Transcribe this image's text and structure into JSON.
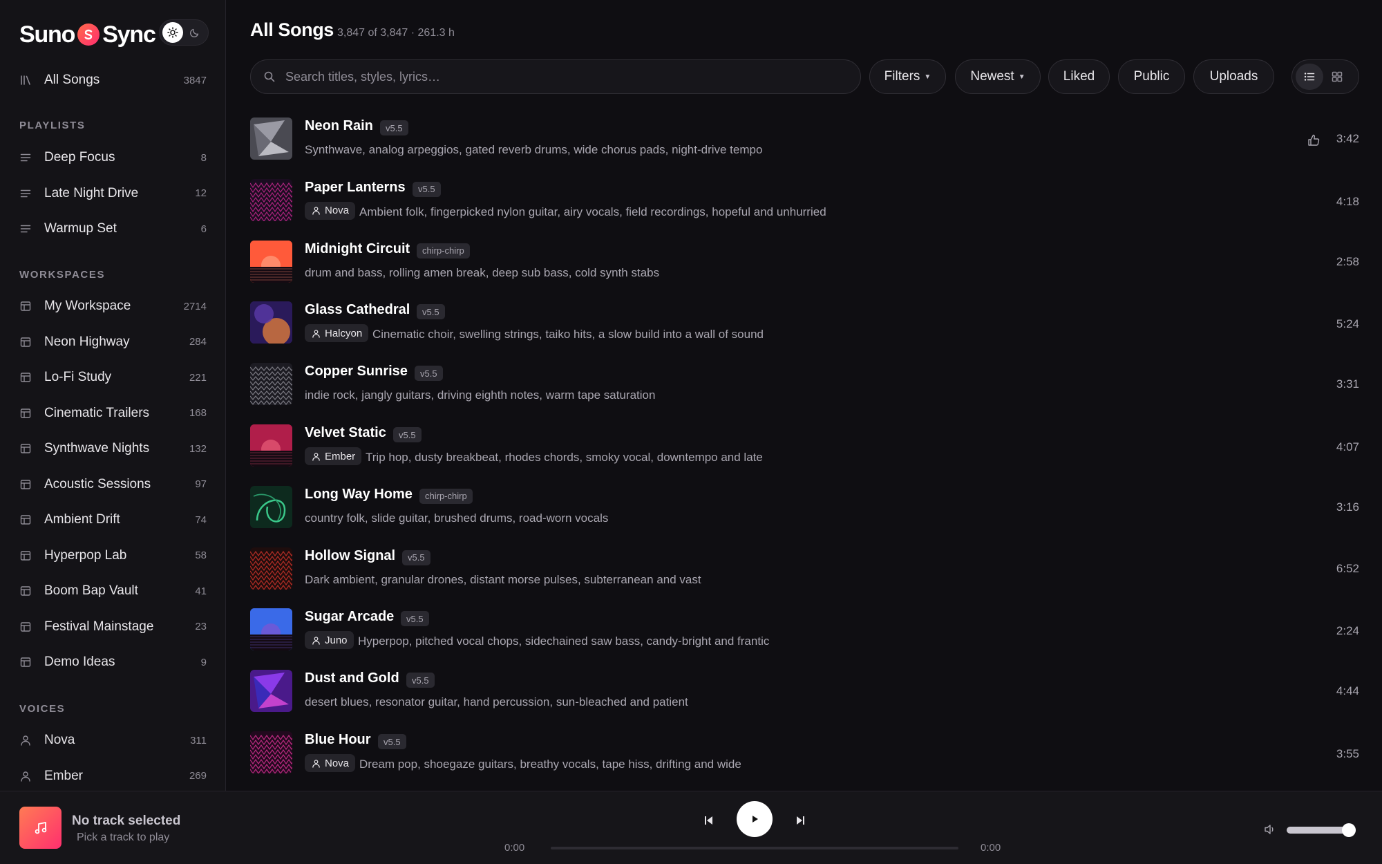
{
  "brand": {
    "name_left": "Suno",
    "name_right": "Sync"
  },
  "sidebar": {
    "all_songs": {
      "label": "All Songs",
      "count": "3847"
    },
    "playlists_heading": "PLAYLISTS",
    "playlists": [
      {
        "label": "Deep Focus",
        "count": "8"
      },
      {
        "label": "Late Night Drive",
        "count": "12"
      },
      {
        "label": "Warmup Set",
        "count": "6"
      }
    ],
    "workspaces_heading": "WORKSPACES",
    "workspaces": [
      {
        "label": "My Workspace",
        "count": "2714"
      },
      {
        "label": "Neon Highway",
        "count": "284"
      },
      {
        "label": "Lo-Fi Study",
        "count": "221"
      },
      {
        "label": "Cinematic Trailers",
        "count": "168"
      },
      {
        "label": "Synthwave Nights",
        "count": "132"
      },
      {
        "label": "Acoustic Sessions",
        "count": "97"
      },
      {
        "label": "Ambient Drift",
        "count": "74"
      },
      {
        "label": "Hyperpop Lab",
        "count": "58"
      },
      {
        "label": "Boom Bap Vault",
        "count": "41"
      },
      {
        "label": "Festival Mainstage",
        "count": "23"
      },
      {
        "label": "Demo Ideas",
        "count": "9"
      }
    ],
    "voices_heading": "VOICES",
    "voices": [
      {
        "label": "Nova",
        "count": "311"
      },
      {
        "label": "Ember",
        "count": "269"
      }
    ]
  },
  "header": {
    "title": "All Songs",
    "subtitle": "3,847 of 3,847 · 261.3 h",
    "search_placeholder": "Search titles, styles, lyrics…",
    "filters_label": "Filters",
    "sort_label": "Newest",
    "liked_label": "Liked",
    "public_label": "Public",
    "uploads_label": "Uploads"
  },
  "songs": [
    {
      "title": "Neon Rain",
      "version": "v5.5",
      "voice": "",
      "desc": "Synthwave, analog arpeggios, gated reverb drums, wide chorus pads, night-drive tempo",
      "duration": "3:42",
      "thumb": "shard-gray"
    },
    {
      "title": "Paper Lanterns",
      "version": "v5.5",
      "voice": "Nova",
      "desc": "Ambient folk, fingerpicked nylon guitar, airy vocals, field recordings, hopeful and unhurried",
      "duration": "4:18",
      "thumb": "zigzag-magenta"
    },
    {
      "title": "Midnight Circuit",
      "version": "chirp-chirp",
      "voice": "",
      "desc": "drum and bass, rolling amen break, deep sub bass, cold synth stabs",
      "duration": "2:58",
      "thumb": "sunset-red"
    },
    {
      "title": "Glass Cathedral",
      "version": "v5.5",
      "voice": "Halcyon",
      "desc": "Cinematic choir, swelling strings, taiko hits, a slow build into a wall of sound",
      "duration": "5:24",
      "thumb": "nebula"
    },
    {
      "title": "Copper Sunrise",
      "version": "v5.5",
      "voice": "",
      "desc": "indie rock, jangly guitars, driving eighth notes, warm tape saturation",
      "duration": "3:31",
      "thumb": "waves-gray"
    },
    {
      "title": "Velvet Static",
      "version": "v5.5",
      "voice": "Ember",
      "desc": "Trip hop, dusty breakbeat, rhodes chords, smoky vocal, downtempo and late",
      "duration": "4:07",
      "thumb": "sunset-crimson"
    },
    {
      "title": "Long Way Home",
      "version": "chirp-chirp",
      "voice": "",
      "desc": "country folk, slide guitar, brushed drums, road-worn vocals",
      "duration": "3:16",
      "thumb": "swirl-green"
    },
    {
      "title": "Hollow Signal",
      "version": "v5.5",
      "voice": "",
      "desc": "Dark ambient, granular drones, distant morse pulses, subterranean and vast",
      "duration": "6:52",
      "thumb": "zigzag-red"
    },
    {
      "title": "Sugar Arcade",
      "version": "v5.5",
      "voice": "Juno",
      "desc": "Hyperpop, pitched vocal chops, sidechained saw bass, candy-bright and frantic",
      "duration": "2:24",
      "thumb": "sunset-blue"
    },
    {
      "title": "Dust and Gold",
      "version": "v5.5",
      "voice": "",
      "desc": "desert blues, resonator guitar, hand percussion, sun-bleached and patient",
      "duration": "4:44",
      "thumb": "shard-violet"
    },
    {
      "title": "Blue Hour",
      "version": "v5.5",
      "voice": "Nova",
      "desc": "Dream pop, shoegaze guitars, breathy vocals, tape hiss, drifting and wide",
      "duration": "3:55",
      "thumb": "zigzag-pink"
    }
  ],
  "player": {
    "title": "No track selected",
    "subtitle": "Pick a track to play",
    "time_current": "0:00",
    "time_total": "0:00",
    "progress": 0,
    "volume": 0.9
  },
  "colors": {
    "accent": "#ff3d6e",
    "background": "#0f0e12",
    "sidebar": "#141317"
  }
}
